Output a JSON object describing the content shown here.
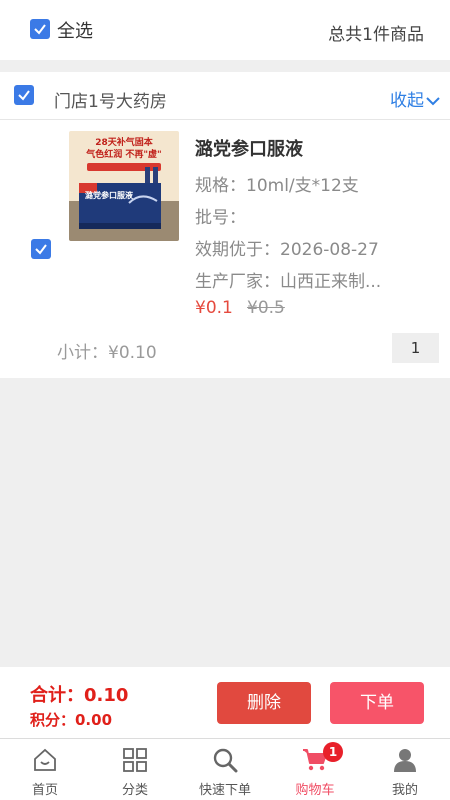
{
  "header": {
    "select_all_label": "全选",
    "total_items": "总共1件商品"
  },
  "store": {
    "name": "门店1号大药房",
    "collapse_label": "收起"
  },
  "product": {
    "name": "潞党参口服液",
    "spec": "规格：10ml/支*12支",
    "batch": "批号：",
    "expiry": "效期优于：2026-08-27",
    "manufacturer": "生产厂家：山西正来制...",
    "price": "¥0.1",
    "original_price": "¥0.5",
    "image_text_line1": "28天补气固本",
    "image_text_line2": "气色红润 不再\"虚\"",
    "image_box_text": "潞党参口服液"
  },
  "subtotal": "小计：¥0.10",
  "quantity": "1",
  "footer": {
    "total": "合计：0.10",
    "points": "积分：0.00",
    "delete_label": "删除",
    "order_label": "下单"
  },
  "tabs": [
    {
      "label": "首页",
      "icon": "home-icon"
    },
    {
      "label": "分类",
      "icon": "category-icon"
    },
    {
      "label": "快速下单",
      "icon": "search-icon"
    },
    {
      "label": "购物车",
      "icon": "cart-icon",
      "badge": "1",
      "active": true
    },
    {
      "label": "我的",
      "icon": "user-icon"
    }
  ],
  "colors": {
    "accent_blue": "#3b7ae6",
    "price_red": "#e54a3e",
    "delete_red": "#e1493f",
    "order_pink": "#f75469",
    "active_tab": "#f04d64"
  }
}
